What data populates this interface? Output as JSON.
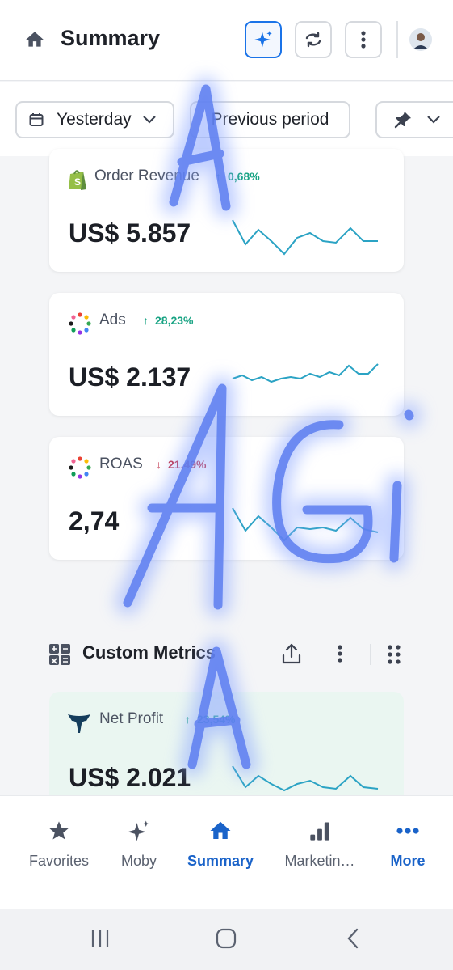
{
  "header": {
    "title": "Summary",
    "icons": [
      "home-icon",
      "sparkle-icon",
      "refresh-icon",
      "kebab-menu-icon",
      "avatar"
    ]
  },
  "filters": {
    "date_range": "Yesterday",
    "compare": "Previous period",
    "pin_icon": "pin-icon"
  },
  "metrics": [
    {
      "name": "Order Revenue",
      "change": "0,68%",
      "direction": "up",
      "value": "US$ 5.857",
      "icon": "shopify-icon"
    },
    {
      "name": "Ads",
      "change": "28,23%",
      "direction": "up",
      "value": "US$ 2.137",
      "icon": "dots-ring-icon"
    },
    {
      "name": "ROAS",
      "change": "21,49%",
      "direction": "down",
      "value": "2,74",
      "icon": "dots-ring-icon"
    }
  ],
  "custom_metrics": {
    "title": "Custom Metrics",
    "card": {
      "name": "Net Profit",
      "change": "23,54%",
      "direction": "up",
      "value": "US$ 2.021",
      "icon": "triple-whale-icon"
    }
  },
  "bottom_nav": [
    {
      "label": "Favorites",
      "icon": "star-icon",
      "active": false
    },
    {
      "label": "Moby",
      "icon": "sparkle-icon",
      "active": false
    },
    {
      "label": "Summary",
      "icon": "home-icon",
      "active": true
    },
    {
      "label": "Marketin…",
      "icon": "bar-chart-icon",
      "active": false
    },
    {
      "label": "More",
      "icon": "more-dots-icon",
      "active": false
    }
  ],
  "watermark": "AGi",
  "colors": {
    "accent": "#1a73e8",
    "up": "#18a383",
    "down": "#c4344a",
    "spark": "#2ba3c4"
  }
}
